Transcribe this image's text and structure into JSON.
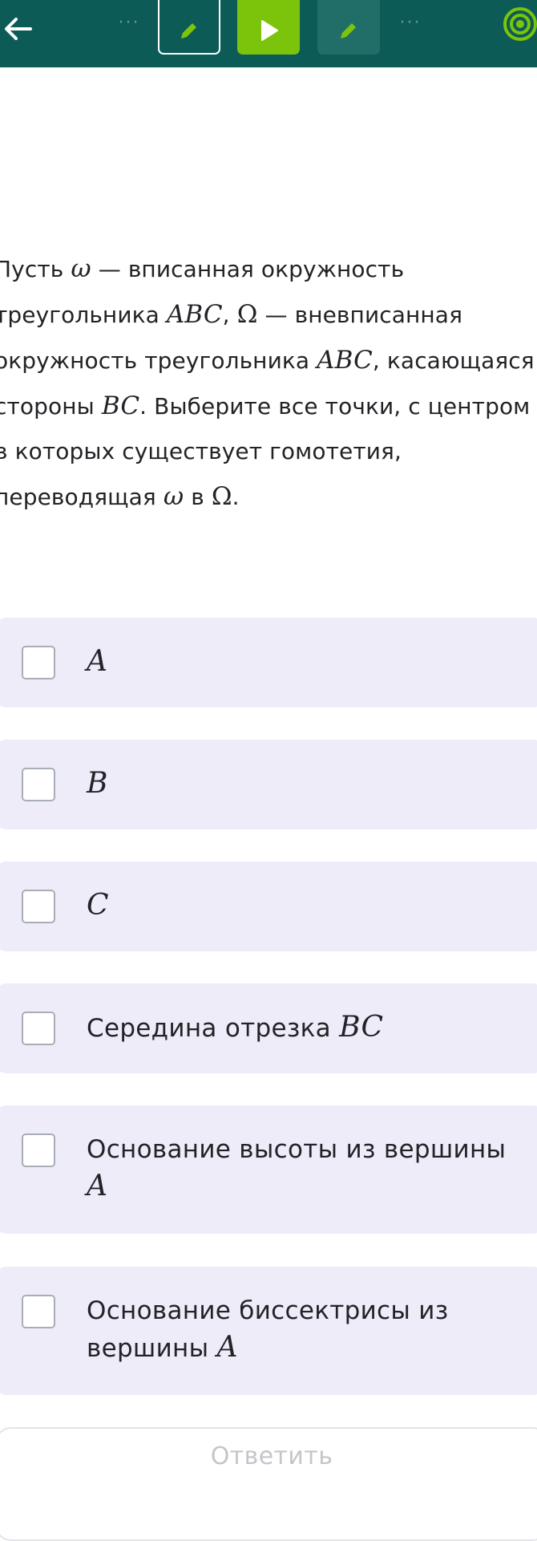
{
  "colors": {
    "header_bg": "#0c5b57",
    "active_step": "#7cc40b",
    "option_bg": "#efecf9",
    "text": "#232327",
    "disabled_text": "#c3c5ca"
  },
  "header": {
    "back_icon": "arrow-left-icon",
    "dots_left": "···",
    "dots_right": "···",
    "steps": [
      {
        "icon": "pencil-icon",
        "state": "current-outline"
      },
      {
        "icon": "play-icon",
        "state": "active"
      },
      {
        "icon": "pencil-icon",
        "state": "inactive"
      }
    ],
    "progress_icon": "target-icon"
  },
  "question": {
    "l1_a": "Пусть ",
    "omega": "ω",
    "l1_b": " — вписанная окружность",
    "l2_a": "треугольника ",
    "abc": "ABC",
    "l2_b": ", ",
    "Omega": "Ω",
    "l2_c": " — вневписанная",
    "l3_a": "окружность треугольника ",
    "l3_b": ", касающаяся",
    "l4_a": "стороны ",
    "bc": "BC",
    "l4_b": ". Выберите все точки, с центром",
    "l5": "в которых существует гомотетия,",
    "l6_a": "переводящая ",
    "l6_b": " в ",
    "l6_c": "."
  },
  "options": [
    {
      "text": "",
      "math": "A",
      "checked": false
    },
    {
      "text": "",
      "math": "B",
      "checked": false
    },
    {
      "text": "",
      "math": "C",
      "checked": false
    },
    {
      "text": "Середина отрезка ",
      "math": "BC",
      "checked": false
    },
    {
      "text": "Основание высоты из вершины",
      "math": "A",
      "checked": false
    },
    {
      "text": "Основание биссектрисы из вершины ",
      "math": "A",
      "checked": false
    }
  ],
  "answer_button": {
    "label": "Ответить",
    "enabled": false
  }
}
